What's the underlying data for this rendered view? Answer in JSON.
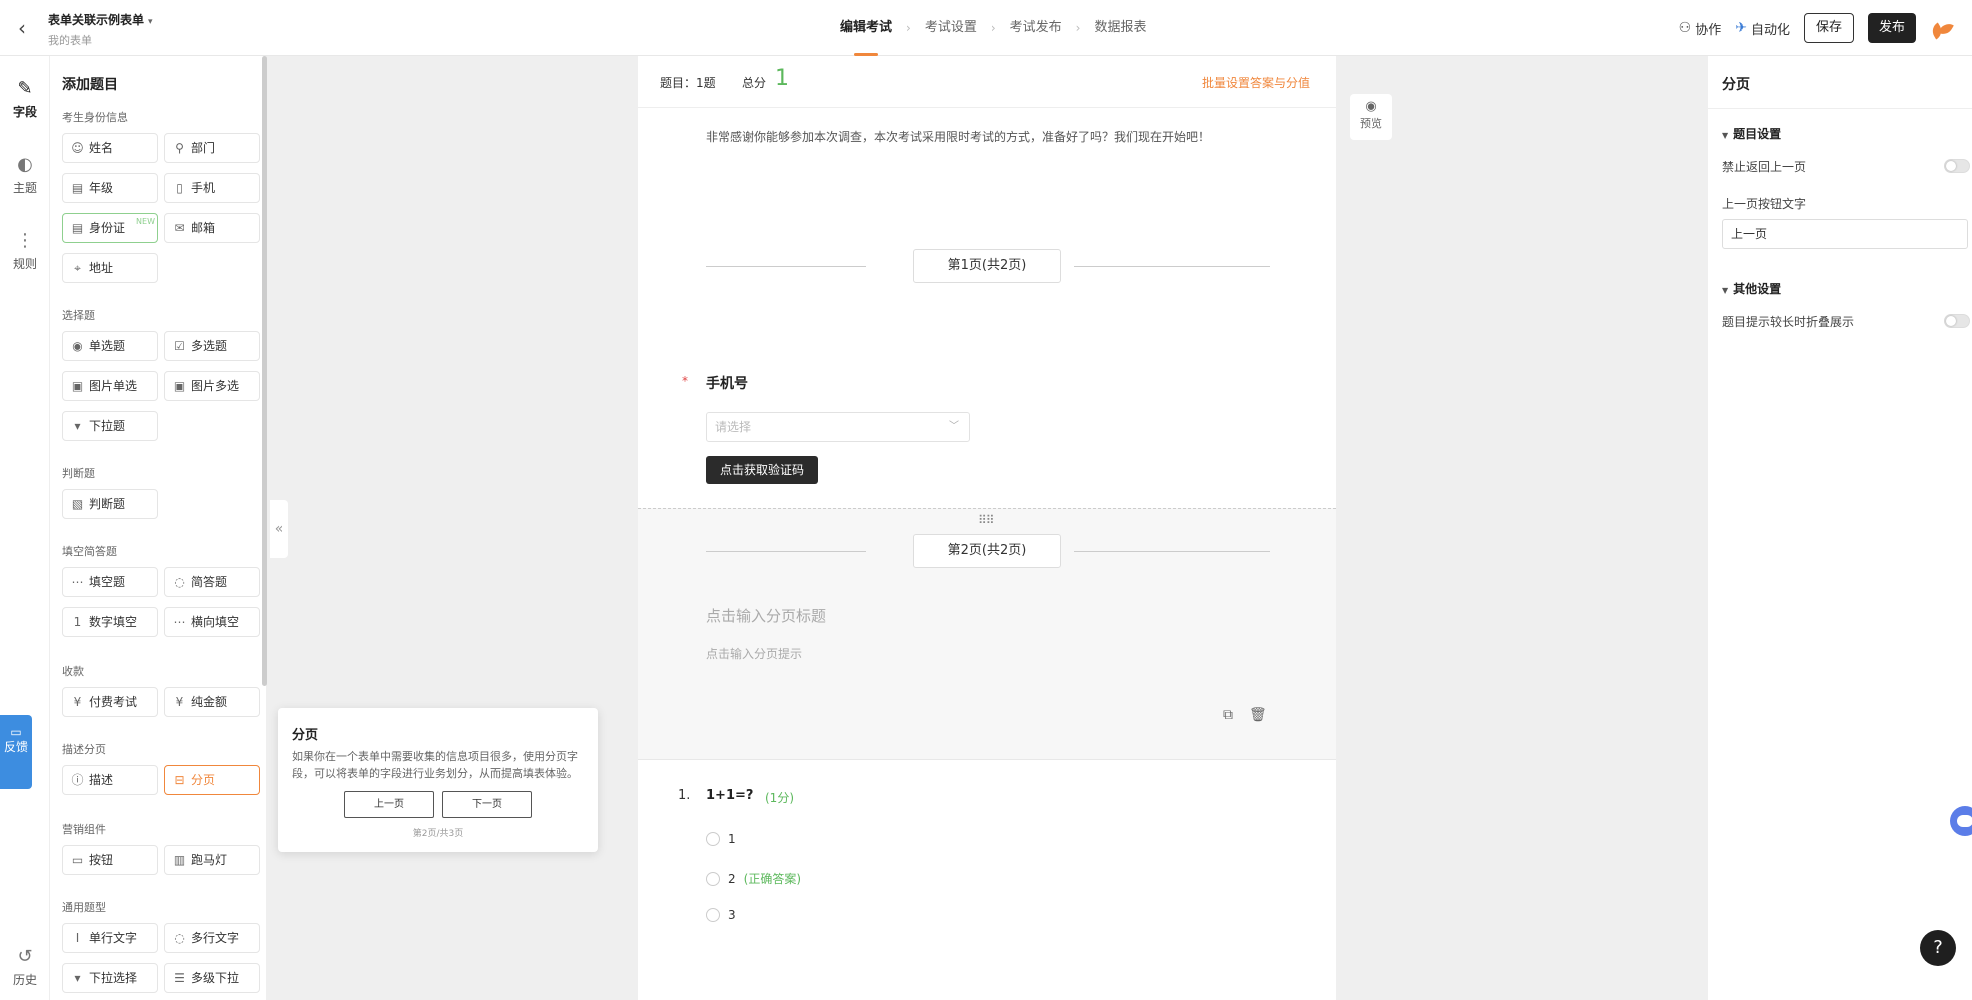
{
  "topbar": {
    "form_title": "表单关联示例表单",
    "form_subtitle": "我的表单",
    "steps": [
      "编辑考试",
      "考试设置",
      "考试发布",
      "数据报表"
    ],
    "collaborate": "协作",
    "automate": "自动化",
    "save": "保存",
    "publish": "发布"
  },
  "rail": {
    "items": [
      "字段",
      "主题",
      "规则"
    ],
    "history": "历史",
    "feedback": "反馈"
  },
  "panel": {
    "title": "添加题目",
    "groups": [
      {
        "label": "考生身份信息",
        "items": [
          "姓名",
          "部门",
          "年级",
          "手机",
          "身份证",
          "邮箱",
          "地址"
        ]
      },
      {
        "label": "选择题",
        "items": [
          "单选题",
          "多选题",
          "图片单选",
          "图片多选",
          "下拉题"
        ]
      },
      {
        "label": "判断题",
        "items": [
          "判断题"
        ]
      },
      {
        "label": "填空简答题",
        "items": [
          "填空题",
          "简答题",
          "数字填空",
          "横向填空"
        ]
      },
      {
        "label": "收款",
        "items": [
          "付费考试",
          "纯金额"
        ]
      },
      {
        "label": "描述分页",
        "items": [
          "描述",
          "分页"
        ]
      },
      {
        "label": "营销组件",
        "items": [
          "按钮",
          "跑马灯"
        ]
      },
      {
        "label": "通用题型",
        "items": [
          "单行文字",
          "多行文字",
          "下拉选择",
          "多级下拉"
        ]
      }
    ],
    "new_tag": "NEW"
  },
  "tooltip": {
    "title": "分页",
    "desc": "如果你在一个表单中需要收集的信息项目很多，使用分页字段，可以将表单的字段进行业务划分，从而提高填表体验。",
    "prev": "上一页",
    "next": "下一页",
    "page": "第2页/共3页"
  },
  "canvas": {
    "count_label": "题目：1题",
    "total_label": "总分",
    "total_value": "1",
    "batch": "批量设置答案与分值",
    "intro": "非常感谢你能够参加本次调查，本次考试采用限时考试的方式，准备好了吗？我们现在开始吧！",
    "page1": "第1页(共2页)",
    "page2": "第2页(共2页)",
    "q1_title": "手机号",
    "q1_placeholder": "请选择",
    "q1_button": "点击获取验证码",
    "page_title_ph": "点击输入分页标题",
    "page_hint_ph": "点击输入分页提示",
    "q2_num": "1.",
    "q2_title": "1+1=?",
    "q2_score": "(1分)",
    "options": [
      "1",
      "2",
      "3"
    ],
    "correct": "(正确答案)"
  },
  "preview": "预览",
  "right": {
    "title": "分页",
    "section1": "题目设置",
    "no_back": "禁止返回上一页",
    "prev_text_label": "上一页按钮文字",
    "prev_text_value": "上一页",
    "section2": "其他设置",
    "fold": "题目提示较长时折叠展示"
  },
  "help": "?"
}
